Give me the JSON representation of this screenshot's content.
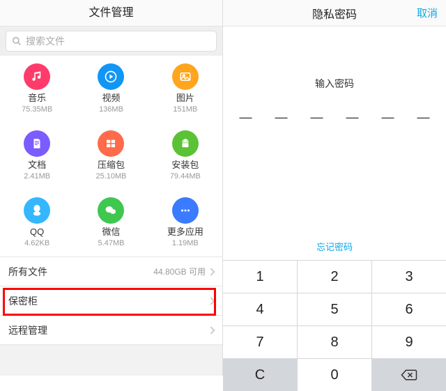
{
  "left": {
    "title": "文件管理",
    "search_placeholder": "搜索文件",
    "cats": [
      {
        "label": "音乐",
        "size": "75.35MB",
        "color": "#ff3b6b",
        "icon": "music"
      },
      {
        "label": "视频",
        "size": "136MB",
        "color": "#1196f5",
        "icon": "play"
      },
      {
        "label": "图片",
        "size": "151MB",
        "color": "#ffa51e",
        "icon": "photo"
      },
      {
        "label": "文档",
        "size": "2.41MB",
        "color": "#7a5cff",
        "icon": "doc"
      },
      {
        "label": "压缩包",
        "size": "25.10MB",
        "color": "#ff6b4a",
        "icon": "zip"
      },
      {
        "label": "安装包",
        "size": "79.44MB",
        "color": "#5bc236",
        "icon": "android"
      },
      {
        "label": "QQ",
        "size": "4.62KB",
        "color": "#34b7ff",
        "icon": "qq"
      },
      {
        "label": "微信",
        "size": "5.47MB",
        "color": "#3fc750",
        "icon": "wechat"
      },
      {
        "label": "更多应用",
        "size": "1.19MB",
        "color": "#3a7bff",
        "icon": "more"
      }
    ],
    "rows": {
      "all_files": "所有文件",
      "all_files_info": "44.80GB 可用",
      "vault": "保密柜",
      "remote": "远程管理"
    }
  },
  "right": {
    "title": "隐私密码",
    "cancel": "取消",
    "prompt": "输入密码",
    "dashes": "— — — — — —",
    "forgot": "忘记密码",
    "keys": {
      "k1": "1",
      "k2": "2",
      "k3": "3",
      "k4": "4",
      "k5": "5",
      "k6": "6",
      "k7": "7",
      "k8": "8",
      "k9": "9",
      "k0": "0",
      "kc": "C"
    }
  }
}
